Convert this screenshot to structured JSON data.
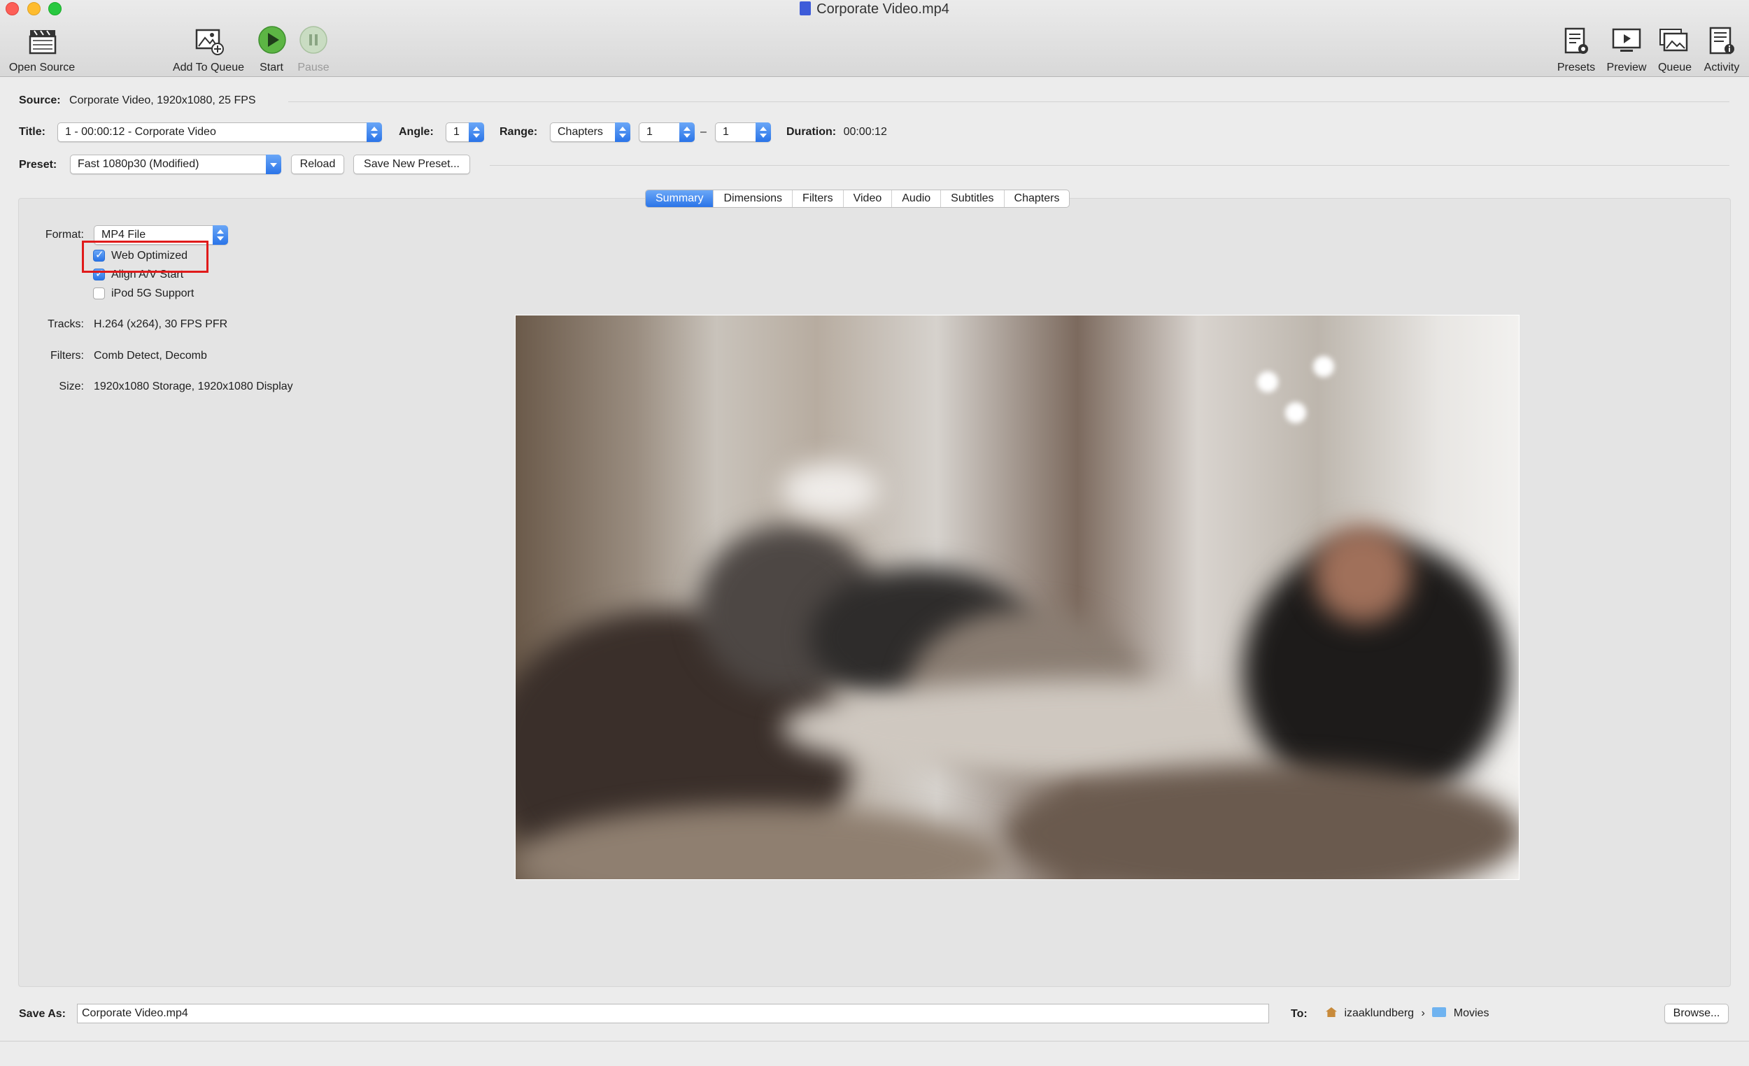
{
  "window": {
    "title": "Corporate Video.mp4"
  },
  "toolbar": {
    "open_source": "Open Source",
    "add_to_queue": "Add To Queue",
    "start": "Start",
    "pause": "Pause",
    "presets": "Presets",
    "preview": "Preview",
    "queue": "Queue",
    "activity": "Activity"
  },
  "source": {
    "label": "Source:",
    "value": "Corporate Video, 1920x1080, 25 FPS"
  },
  "title_row": {
    "title_label": "Title:",
    "title_value": "1 - 00:00:12 - Corporate Video",
    "angle_label": "Angle:",
    "angle_value": "1",
    "range_label": "Range:",
    "range_value": "Chapters",
    "range_start": "1",
    "range_dash": "–",
    "range_end": "1",
    "duration_label": "Duration:",
    "duration_value": "00:00:12"
  },
  "preset_row": {
    "label": "Preset:",
    "value": "Fast 1080p30 (Modified)",
    "reload": "Reload",
    "save_new": "Save New Preset..."
  },
  "tabs": [
    "Summary",
    "Dimensions",
    "Filters",
    "Video",
    "Audio",
    "Subtitles",
    "Chapters"
  ],
  "summary": {
    "format_label": "Format:",
    "format_value": "MP4 File",
    "options": [
      {
        "label": "Web Optimized",
        "checked": true
      },
      {
        "label": "Align A/V Start",
        "checked": true
      },
      {
        "label": "iPod 5G Support",
        "checked": false
      }
    ],
    "tracks_label": "Tracks:",
    "tracks_value": "H.264 (x264), 30 FPS PFR",
    "filters_label": "Filters:",
    "filters_value": "Comb Detect, Decomb",
    "size_label": "Size:",
    "size_value": "1920x1080 Storage, 1920x1080 Display"
  },
  "save": {
    "label": "Save As:",
    "filename": "Corporate Video.mp4",
    "to_label": "To:",
    "path_user": "izaaklundberg",
    "path_sep": "›",
    "path_folder": "Movies",
    "browse": "Browse..."
  },
  "colors": {
    "accent": "#2a74e8",
    "highlight_box": "#e01b1b",
    "start_green": "#34a853"
  }
}
